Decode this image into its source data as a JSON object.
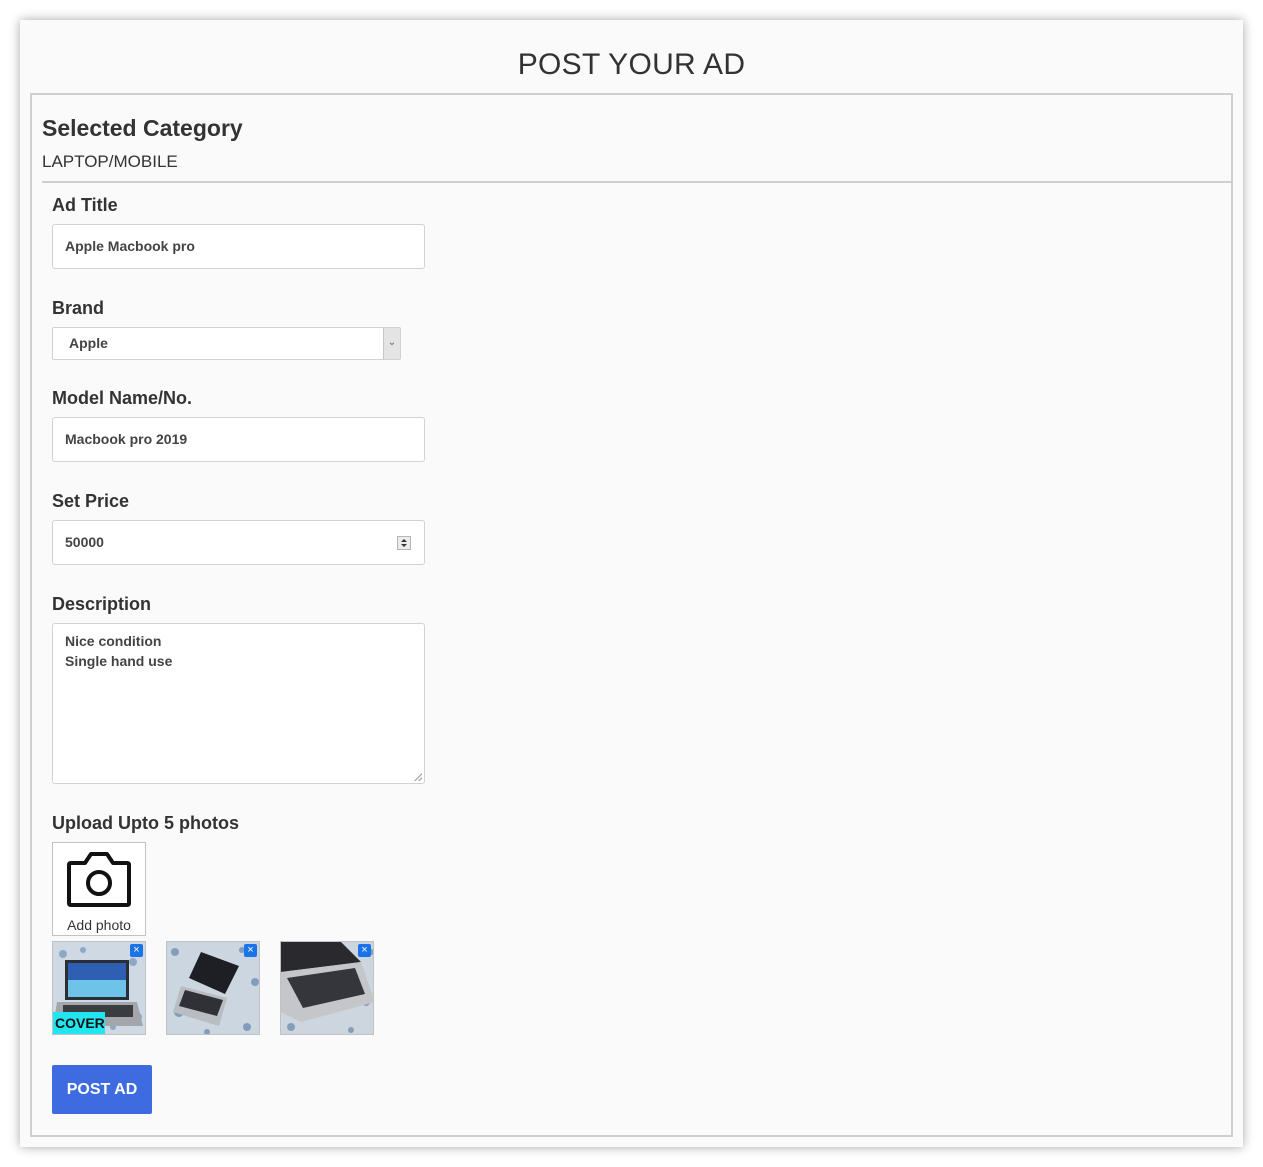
{
  "page_title": "POST YOUR AD",
  "category": {
    "heading": "Selected Category",
    "value": "LAPTOP/MOBILE"
  },
  "form": {
    "ad_title": {
      "label": "Ad Title",
      "value": "Apple Macbook pro"
    },
    "brand": {
      "label": "Brand",
      "selected": "Apple"
    },
    "model": {
      "label": "Model Name/No.",
      "value": "Macbook pro 2019"
    },
    "price": {
      "label": "Set Price",
      "value": "50000"
    },
    "description": {
      "label": "Description",
      "lines": [
        "Nice condition",
        "Single hand use"
      ]
    },
    "photos": {
      "label": "Upload Upto 5 photos",
      "add_label": "Add photo",
      "cover_label": "COVER",
      "remove_glyph": "×",
      "count": 3
    },
    "submit_label": "POST AD"
  },
  "colors": {
    "primary_button": "#3e6ce0",
    "remove_icon": "#1a73e8",
    "cover_badge": "#22e6ef"
  },
  "icons": [
    "camera-icon",
    "close-icon",
    "select-arrow-icon",
    "spinner-icon"
  ]
}
